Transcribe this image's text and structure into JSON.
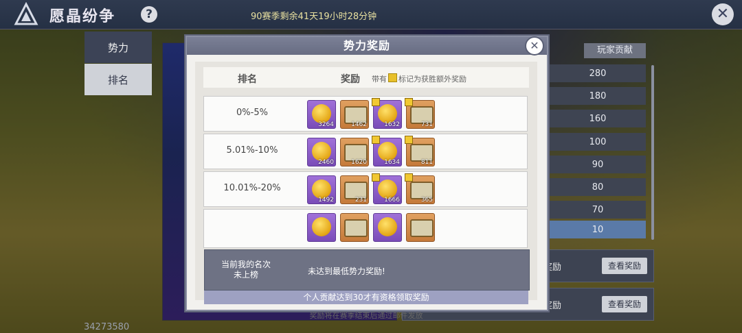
{
  "topbar": {
    "title": "愿晶纷争",
    "help": "?",
    "season_remaining": "90赛季剩余41天19小时28分钟",
    "close": "✕"
  },
  "side_tabs": [
    "势力",
    "排名"
  ],
  "right_panel": {
    "header": "玩家贡献",
    "values": [
      "280",
      "180",
      "160",
      "100",
      "90",
      "80",
      "70",
      "10"
    ],
    "reward_label": "奖励",
    "view_reward": "查看奖励"
  },
  "uid": "34273580",
  "modal": {
    "title": "势力奖励",
    "close": "✕",
    "col_rank": "排名",
    "col_reward": "奖励",
    "note_prefix": "带有",
    "note_suffix": "标记为获胜额外奖励",
    "rows": [
      {
        "label": "0%-5%",
        "items": [
          {
            "type": "coin",
            "qty": "3264",
            "marked": false
          },
          {
            "type": "chest",
            "qty": "1462",
            "marked": false
          },
          {
            "type": "coin",
            "qty": "1632",
            "marked": true
          },
          {
            "type": "chest",
            "qty": "731",
            "marked": true
          }
        ]
      },
      {
        "label": "5.01%-10%",
        "items": [
          {
            "type": "coin",
            "qty": "2460",
            "marked": false
          },
          {
            "type": "chest",
            "qty": "1620",
            "marked": false
          },
          {
            "type": "coin",
            "qty": "1634",
            "marked": true
          },
          {
            "type": "chest",
            "qty": "811",
            "marked": true
          }
        ]
      },
      {
        "label": "10.01%-20%",
        "items": [
          {
            "type": "coin",
            "qty": "1492",
            "marked": false
          },
          {
            "type": "chest",
            "qty": "231",
            "marked": false
          },
          {
            "type": "coin",
            "qty": "1666",
            "marked": true
          },
          {
            "type": "chest",
            "qty": "365",
            "marked": true
          }
        ]
      }
    ],
    "my_rank_label": "当前我的名次",
    "my_rank_value": "未上榜",
    "my_status": "未达到最低势力奖励!",
    "requirement": "个人贡献达到30才有资格领取奖励",
    "footer": "奖励将在赛季结束后通过邮件发放"
  },
  "colors": {
    "coin_bg": "#8a5cc8",
    "chest_bg": "#d38d4c",
    "mark": "#f1c832",
    "header_bar": "#707589"
  }
}
